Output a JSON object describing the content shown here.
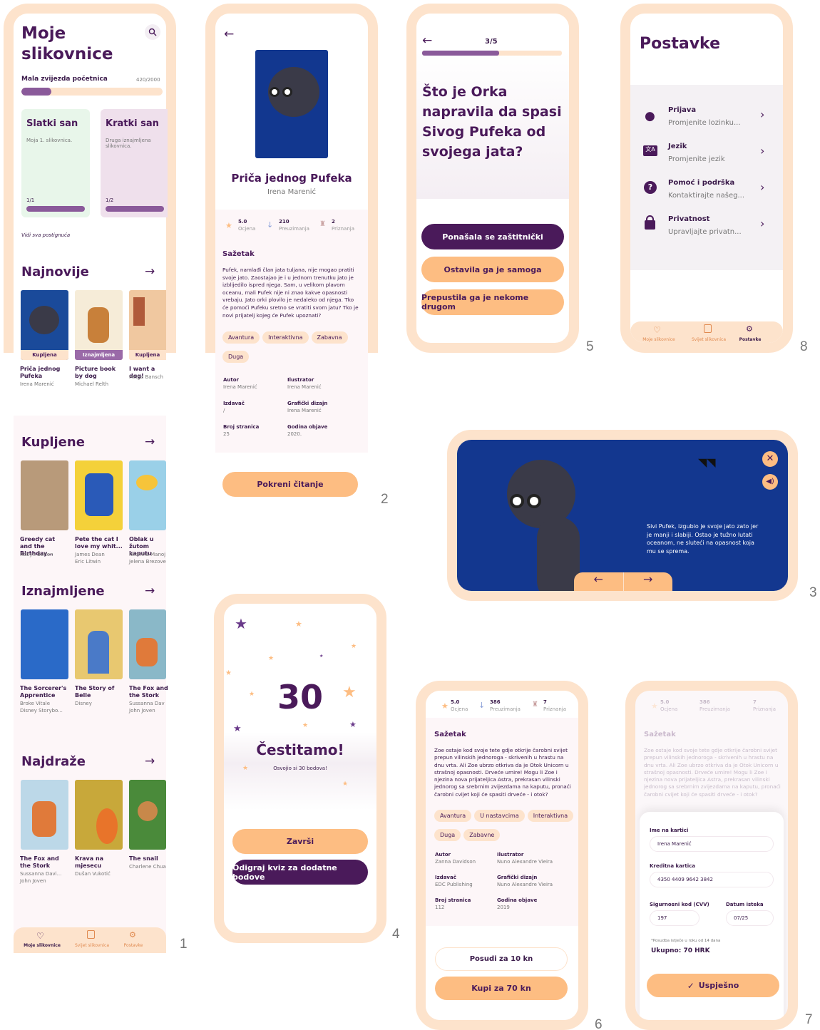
{
  "screen1": {
    "title": "Moje slikovnice",
    "level": "Mala zvijezda početnica",
    "points": "420/2000",
    "progress": 0.21,
    "dreams": [
      {
        "title": "Slatki san",
        "desc": "Moja 1. slikovnica.",
        "count": "1/1"
      },
      {
        "title": "Kratki san",
        "desc": "Druga iznajmljena slikovnica.",
        "count": "1/2"
      }
    ],
    "achievements": "Vidi sva postignuća",
    "sections": [
      {
        "title": "Najnovije",
        "books": [
          {
            "t": "Priča jednog Pufeka",
            "a": "Irena Marenić",
            "badge": "Kupljena"
          },
          {
            "t": "Picture book by dog",
            "a": "Michael Relth",
            "badge": "Iznajmljena"
          },
          {
            "t": "I want a dog!",
            "a": "Helga Bansch",
            "badge": "Kupljena"
          }
        ]
      },
      {
        "title": "Kupljene",
        "books": [
          {
            "t": "Greedy cat and the Birthday...",
            "a": "Robyn Belton"
          },
          {
            "t": "Pete the cat I love my whit...",
            "a": "James Dean Eric Litwin"
          },
          {
            "t": "Oblak u žutom kaputu",
            "a": "Nikolina Manoj Jelena Brezove"
          }
        ]
      },
      {
        "title": "Iznajmljene",
        "books": [
          {
            "t": "The Sorcerer's Apprentice",
            "a": "Broke Vitale Disney Storybo..."
          },
          {
            "t": "The Story of Belle",
            "a": "Disney"
          },
          {
            "t": "The Fox and the Stork",
            "a": "Sussanna Dav John Joven"
          }
        ]
      },
      {
        "title": "Najdraže",
        "books": [
          {
            "t": "The Fox and the Stork",
            "a": "Sussanna Davi... John Joven"
          },
          {
            "t": "Krava na mjesecu",
            "a": "Dušan Vukotić"
          },
          {
            "t": "The snail",
            "a": "Charlene Chua"
          }
        ]
      }
    ],
    "nav": [
      "Moje slikovnice",
      "Svijet slikovnica",
      "Postavke"
    ]
  },
  "screen2": {
    "title": "Priča jednog Pufeka",
    "author": "Irena Marenić",
    "stats": [
      {
        "v": "5.0",
        "l": "Ocjena"
      },
      {
        "v": "210",
        "l": "Preuzimanja"
      },
      {
        "v": "2",
        "l": "Priznanja"
      }
    ],
    "summary_h": "Sažetak",
    "summary": "Pufek, namlađi član jata tuljana, nije mogao pratiti svoje jato. Zaostajao je i u jednom trenutku jato je izblijedilo ispred njega. Sam, u velikom plavom oceanu, mali Pufek nije ni znao kakve opasnosti vrebaju. Jato orki plovilo je nedaleko od njega. Tko će pomoći Pufeku sretno se vratiti svom jatu? Tko je novi prijatelj kojeg će Pufek upoznati?",
    "tags": [
      "Avantura",
      "Interaktivna",
      "Zabavna",
      "Duga"
    ],
    "meta": [
      {
        "l": "Autor",
        "v": "Irena Marenić"
      },
      {
        "l": "Ilustrator",
        "v": "Irena Marenić"
      },
      {
        "l": "Izdavač",
        "v": "/"
      },
      {
        "l": "Grafički dizajn",
        "v": "Irena Marenić"
      },
      {
        "l": "Broj stranica",
        "v": "25"
      },
      {
        "l": "Godina objave",
        "v": "2020."
      }
    ],
    "cta": "Pokreni čitanje"
  },
  "screen3": {
    "text": "Sivi Pufek, izgubio je svoje jato zato jer je manji i slabiji. Ostao je tužno lutati oceanom, ne sluteći na opasnost koja mu se sprema."
  },
  "screen4": {
    "points": "30",
    "title": "Čestitamo!",
    "sub": "Osvojio si 30 bodova!",
    "btn1": "Završi",
    "btn2": "Odigraj kviz za dodatne bodove"
  },
  "screen5": {
    "progress": "3/5",
    "question": "Što je Orka napravila da spasi Sivog Pufeka od svojega jata?",
    "answers": [
      "Ponašala se zaštitnički",
      "Ostavila ga je samoga",
      "Prepustila ga je nekome drugom"
    ]
  },
  "screen6": {
    "stats": [
      {
        "v": "5.0",
        "l": "Ocjena"
      },
      {
        "v": "386",
        "l": "Preuzimanja"
      },
      {
        "v": "7",
        "l": "Priznanja"
      }
    ],
    "summary_h": "Sažetak",
    "summary": "Zoe ostaje kod svoje tete gdje otkrije čarobni svijet prepun vilinskih jednoroga - skrivenih u hrastu na dnu vrta. Ali Zoe ubrzo otkriva da je Otok Unicorn u strašnoj opasnosti. Drveće umire! Mogu li Zoe i njezina nova prijateljica Astra, prekrasan vilinski jednorog sa srebrnim zvijezdama na kaputu, pronaći čarobni cvijet koji će spasiti drveće - i otok?",
    "tags": [
      "Avantura",
      "U nastavcima",
      "Interaktivna",
      "Duga",
      "Zabavne"
    ],
    "meta": [
      {
        "l": "Autor",
        "v": "Zanna Davidson"
      },
      {
        "l": "Ilustrator",
        "v": "Nuno Alexandre Vieira"
      },
      {
        "l": "Izdavač",
        "v": "EDC Publishing"
      },
      {
        "l": "Grafički dizajn",
        "v": "Nuno Alexandre Vieira"
      },
      {
        "l": "Broj stranica",
        "v": "112"
      },
      {
        "l": "Godina objave",
        "v": "2019"
      }
    ],
    "btn1": "Posudi za 10 kn",
    "btn2": "Kupi za 70 kn"
  },
  "screen7": {
    "name_l": "Ime na kartici",
    "name_v": "Irena Marenić",
    "card_l": "Kreditna kartica",
    "card_v": "4350 4409 9642 3842",
    "cvv_l": "Sigurnosni kod (CVV)",
    "cvv_v": "197",
    "exp_l": "Datum isteka",
    "exp_v": "07/25",
    "note": "*Posudba istječe u roku od 14 dana",
    "total": "Ukupno: 70 HRK",
    "btn": "Uspješno"
  },
  "screen8": {
    "title": "Postavke",
    "items": [
      {
        "t": "Prijava",
        "s": "Promjenite lozinku..."
      },
      {
        "t": "Jezik",
        "s": "Promjenite jezik"
      },
      {
        "t": "Pomoć i podrška",
        "s": "Kontaktirajte našeg..."
      },
      {
        "t": "Privatnost",
        "s": "Upravljajte privatn..."
      }
    ],
    "nav": [
      "Moje slikovnice",
      "Svijet slikovnica",
      "Postavke"
    ]
  },
  "numbers": [
    "1",
    "2",
    "3",
    "4",
    "5",
    "6",
    "7",
    "8"
  ]
}
